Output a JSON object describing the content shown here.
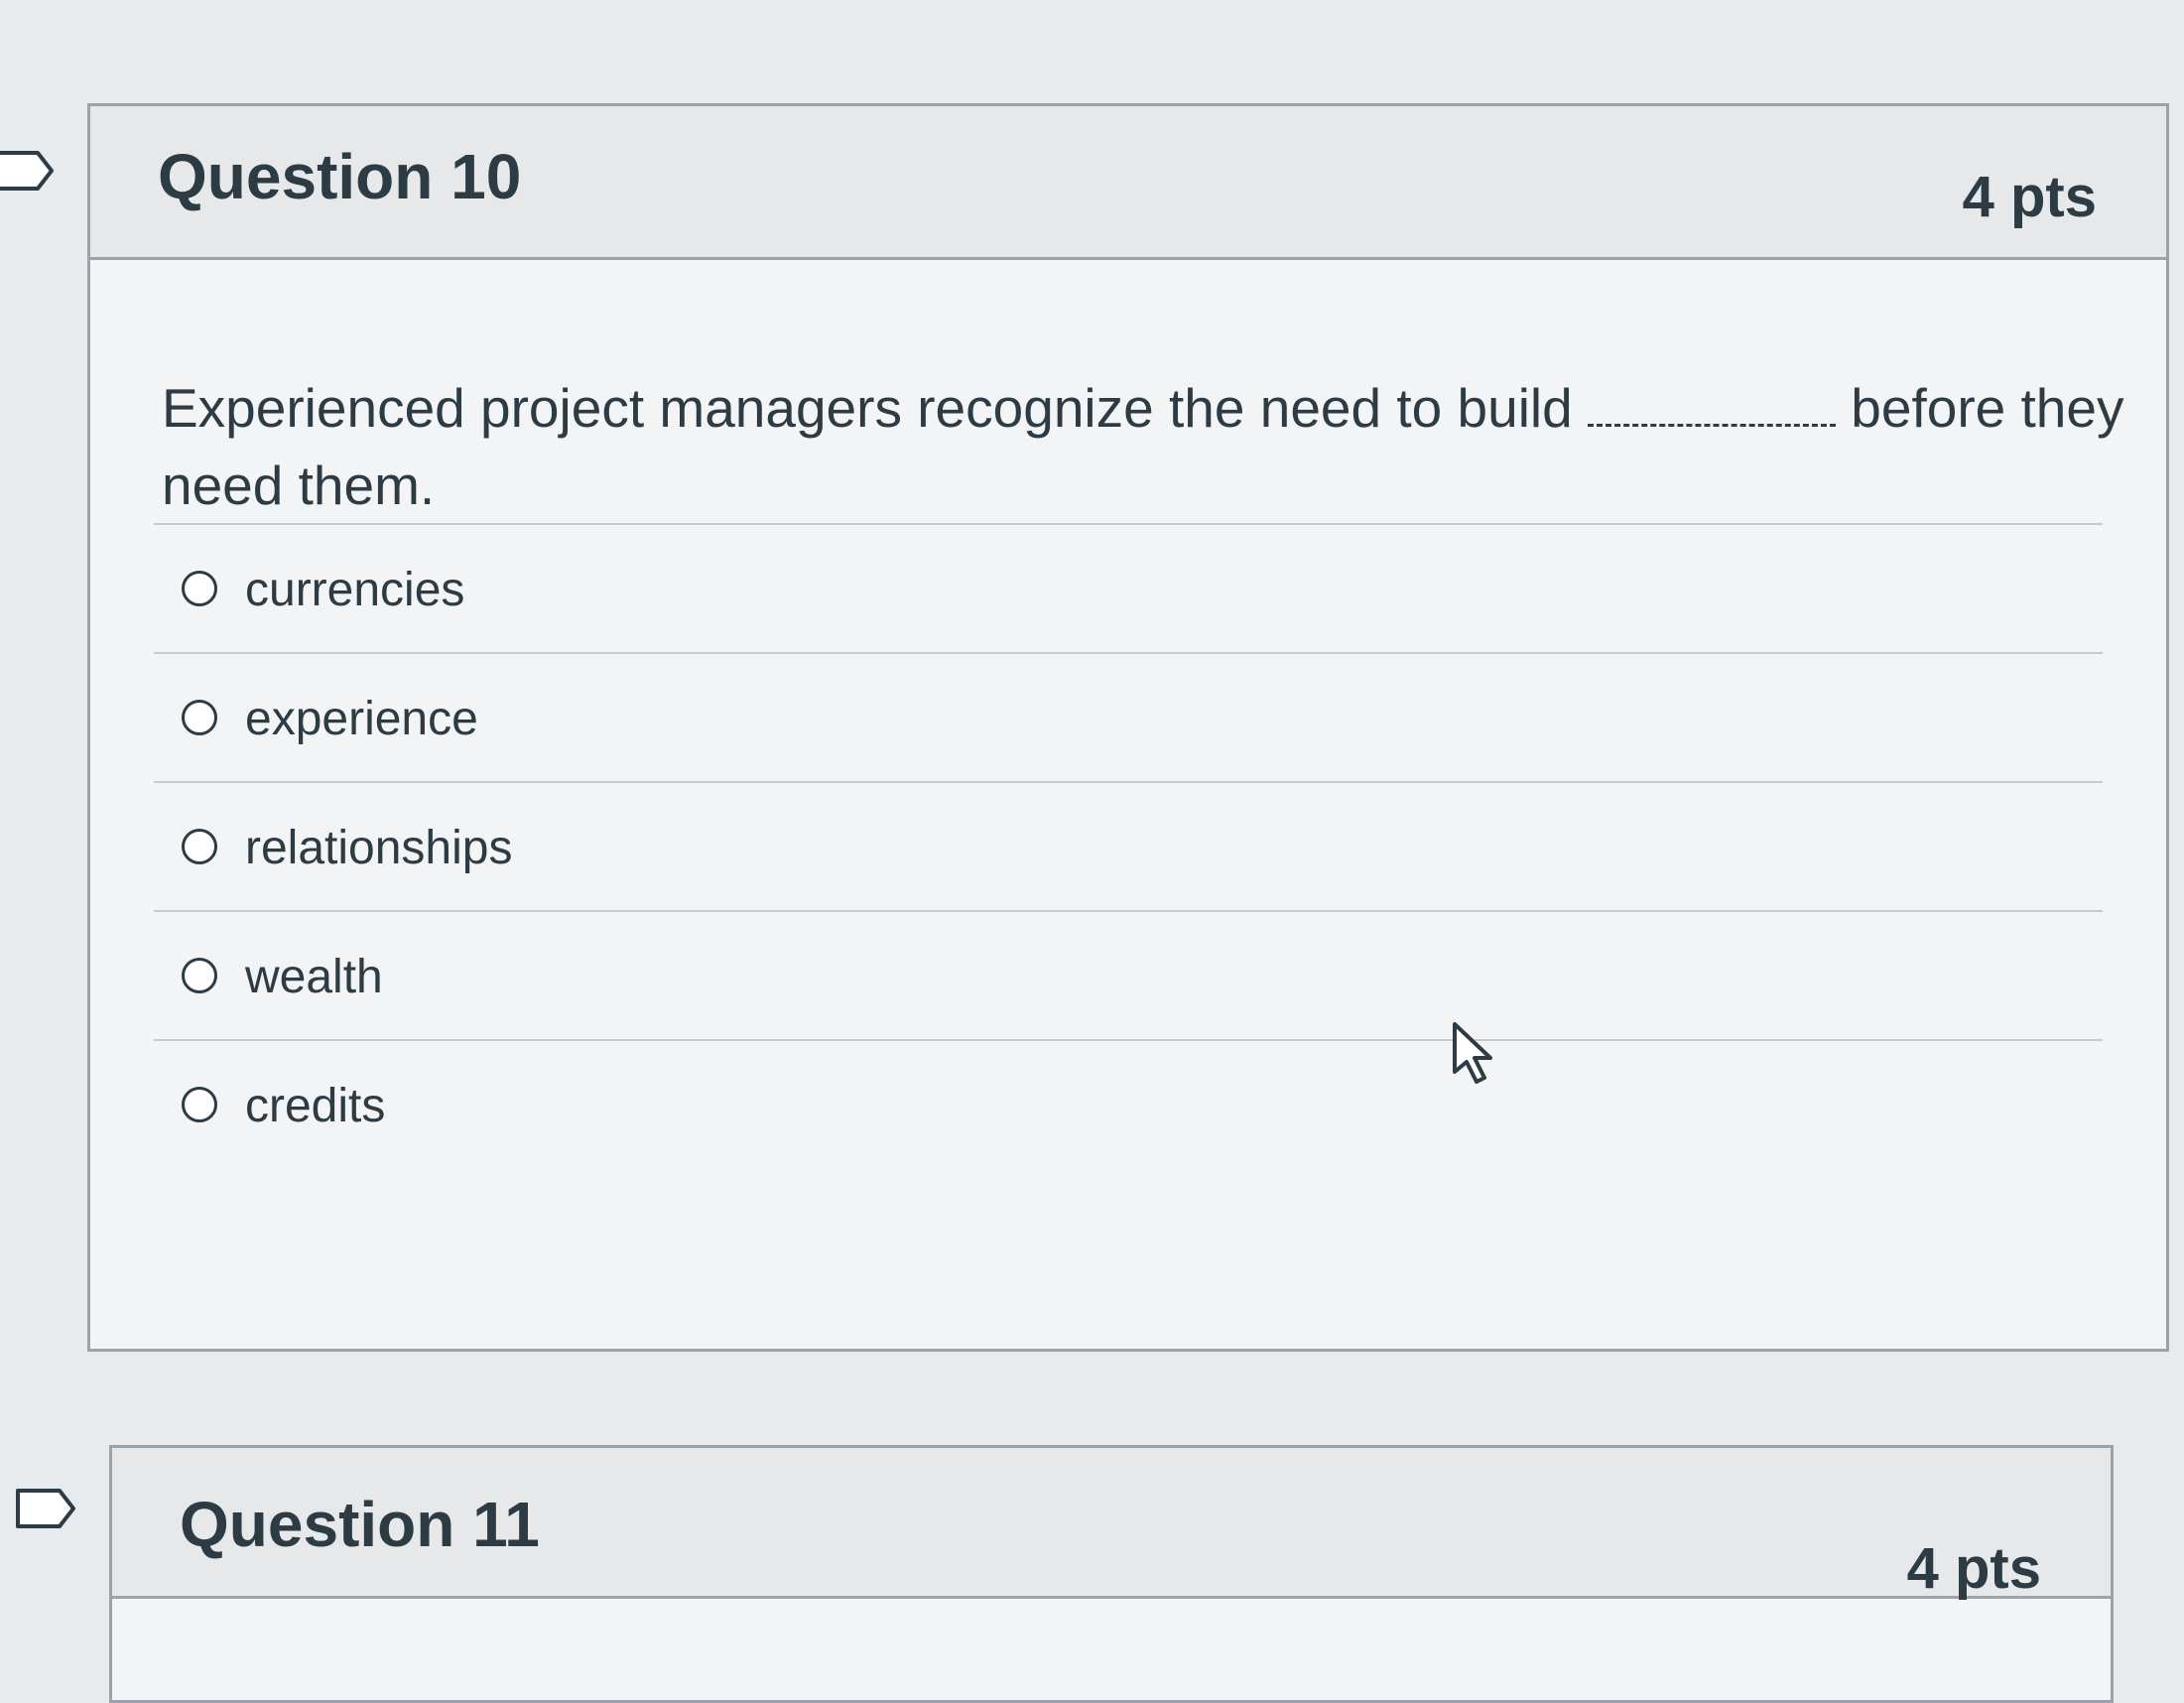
{
  "questions": [
    {
      "title": "Question 10",
      "points": "4 pts",
      "text_before": "Experienced project managers recognize the need to build",
      "text_after": "before they need them.",
      "options": [
        "currencies",
        "experience",
        "relationships",
        "wealth",
        "credits"
      ]
    },
    {
      "title": "Question 11",
      "points": "4 pts"
    }
  ],
  "colors": {
    "text": "#2d3b45",
    "header_bg": "#e6e8ea",
    "border": "#9aa3ab"
  },
  "icons": {
    "flag": "flag-question-icon",
    "cursor": "mouse-pointer-icon",
    "radio": "radio-button-icon"
  }
}
